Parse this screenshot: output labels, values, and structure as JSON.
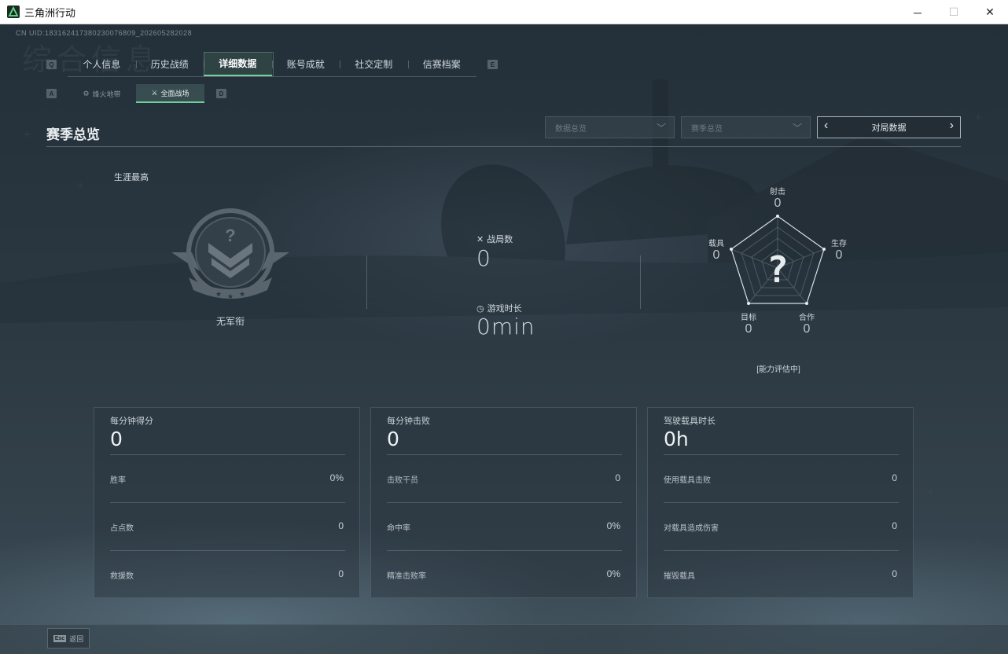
{
  "window": {
    "title": "三角洲行动",
    "controls": [
      "─",
      "☐",
      "✕"
    ]
  },
  "uid": "CN UID:183162417380230076809_202605282028",
  "ghost_title": "综合信息",
  "main_tabs": {
    "left_key": "Q",
    "right_key": "E",
    "items": [
      {
        "label": "个人信息",
        "active": false
      },
      {
        "label": "历史战绩",
        "active": false
      },
      {
        "label": "详细数据",
        "active": true
      },
      {
        "label": "账号成就",
        "active": false
      },
      {
        "label": "社交定制",
        "active": false
      },
      {
        "label": "信赛档案",
        "active": false
      }
    ]
  },
  "sub_tabs": {
    "left_key": "A",
    "right_key": "D",
    "items": [
      {
        "label": "烽火地带",
        "icon": "⚙",
        "active": false
      },
      {
        "label": "全面战场",
        "icon": "⚔",
        "active": true
      }
    ]
  },
  "season": {
    "title": "赛季总览",
    "dropdown1": "数据总览",
    "dropdown2": "赛季总览",
    "pager_label": "对局数据"
  },
  "overview": {
    "career_label": "生涯最高",
    "rank_name": "无军衔",
    "matches_label": "战局数",
    "matches_value": "0",
    "playtime_label": "游戏时长",
    "playtime_value": "0min"
  },
  "radar": {
    "axes": [
      {
        "label": "射击",
        "value": "0"
      },
      {
        "label": "生存",
        "value": "0"
      },
      {
        "label": "合作",
        "value": "0"
      },
      {
        "label": "目标",
        "value": "0"
      },
      {
        "label": "载具",
        "value": "0"
      }
    ],
    "center_symbol": "?",
    "assessment": "[能力评估中]"
  },
  "cards": [
    {
      "title": "每分钟得分",
      "value": "0",
      "rows": [
        {
          "label": "胜率",
          "value": "0%"
        },
        {
          "label": "占点数",
          "value": "0"
        },
        {
          "label": "救援数",
          "value": "0"
        }
      ]
    },
    {
      "title": "每分钟击败",
      "value": "0",
      "rows": [
        {
          "label": "击败干员",
          "value": "0"
        },
        {
          "label": "命中率",
          "value": "0%"
        },
        {
          "label": "精准击败率",
          "value": "0%"
        }
      ]
    },
    {
      "title": "驾驶载具时长",
      "value": "0h",
      "rows": [
        {
          "label": "使用载具击败",
          "value": "0"
        },
        {
          "label": "对载具造成伤害",
          "value": "0"
        },
        {
          "label": "摧毁载具",
          "value": "0"
        }
      ]
    }
  ],
  "back": {
    "key": "Esc",
    "label": "返回"
  },
  "colors": {
    "accent": "#73d29a",
    "background": "#243039"
  }
}
